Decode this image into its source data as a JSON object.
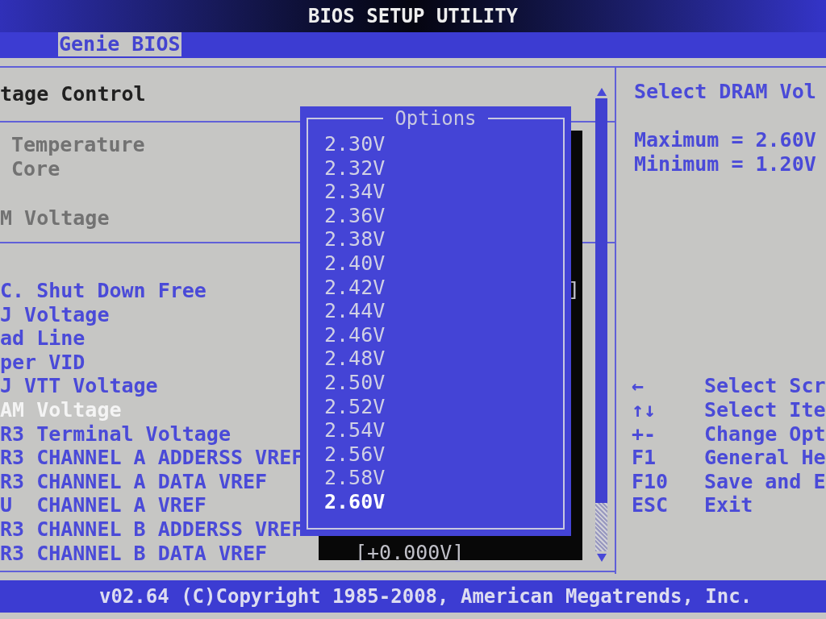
{
  "title": "BIOS SETUP UTILITY",
  "tabs": [
    {
      "label": "Genie BIOS",
      "selected": true
    }
  ],
  "section_title": "tage Control",
  "status_items": [
    {
      "label": "Temperature"
    },
    {
      "label": "Core"
    },
    {
      "label": "M Voltage"
    }
  ],
  "menu_items": [
    {
      "label": "C. Shut Down Free",
      "selected": false,
      "value": "]"
    },
    {
      "label": "J Voltage",
      "selected": false
    },
    {
      "label": "ad Line",
      "selected": false
    },
    {
      "label": "per VID",
      "selected": false
    },
    {
      "label": "J VTT Voltage",
      "selected": false
    },
    {
      "label": "AM Voltage",
      "selected": true
    },
    {
      "label": "R3 Terminal Voltage",
      "selected": false
    },
    {
      "label": "R3 CHANNEL A ADDERSS VREF",
      "selected": false
    },
    {
      "label": "R3 CHANNEL A DATA VREF",
      "selected": false
    },
    {
      "label": "U  CHANNEL A VREF",
      "selected": false
    },
    {
      "label": "R3 CHANNEL B ADDERSS VREF",
      "selected": false
    },
    {
      "label": "R3 CHANNEL B DATA VREF",
      "selected": false,
      "value": "[+0.000V]"
    }
  ],
  "popup": {
    "title": "Options",
    "options": [
      {
        "label": "2.30V",
        "selected": false
      },
      {
        "label": "2.32V",
        "selected": false
      },
      {
        "label": "2.34V",
        "selected": false
      },
      {
        "label": "2.36V",
        "selected": false
      },
      {
        "label": "2.38V",
        "selected": false
      },
      {
        "label": "2.40V",
        "selected": false
      },
      {
        "label": "2.42V",
        "selected": false
      },
      {
        "label": "2.44V",
        "selected": false
      },
      {
        "label": "2.46V",
        "selected": false
      },
      {
        "label": "2.48V",
        "selected": false
      },
      {
        "label": "2.50V",
        "selected": false
      },
      {
        "label": "2.52V",
        "selected": false
      },
      {
        "label": "2.54V",
        "selected": false
      },
      {
        "label": "2.56V",
        "selected": false
      },
      {
        "label": "2.58V",
        "selected": false
      },
      {
        "label": "2.60V",
        "selected": true
      }
    ]
  },
  "help": {
    "title": "Select DRAM Vol",
    "lines": [
      "Maximum = 2.60V",
      "Minimum = 1.20V"
    ]
  },
  "keys": [
    {
      "key": "←",
      "action": "Select Scr"
    },
    {
      "key": "↑↓",
      "action": "Select Ite"
    },
    {
      "key": "+-",
      "action": "Change Opt"
    },
    {
      "key": "F1",
      "action": "General He"
    },
    {
      "key": "F10",
      "action": "Save and E"
    },
    {
      "key": "ESC",
      "action": "Exit"
    }
  ],
  "footer": "v02.64 (C)Copyright 1985-2008, American Megatrends, Inc."
}
